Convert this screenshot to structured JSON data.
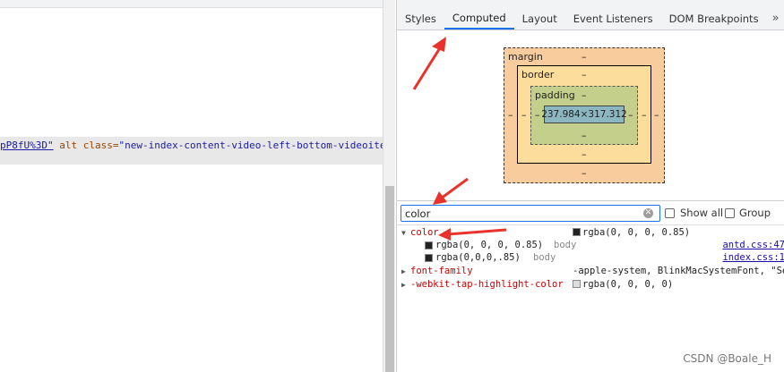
{
  "dom_line": {
    "link_text": "pP8fU%3D\"",
    "attr_alt": "alt",
    "attr_class": "class=",
    "class_value": "\"new-index-content-video-left-bottom-videoitem-cove"
  },
  "tabs": [
    {
      "label": "Styles"
    },
    {
      "label": "Computed"
    },
    {
      "label": "Layout"
    },
    {
      "label": "Event Listeners"
    },
    {
      "label": "DOM Breakpoints"
    }
  ],
  "tabs_more": "»",
  "box_model": {
    "margin_label": "margin",
    "border_label": "border",
    "padding_label": "padding",
    "dash": "–",
    "content_size": "237.984×317.312"
  },
  "filter": {
    "value": "color",
    "clear": "✕",
    "show_all_label": "Show all",
    "group_label": "Group"
  },
  "properties": {
    "color": {
      "name": "color",
      "value": "rgba(0, 0, 0, 0.85)",
      "swatch": "#222222",
      "traces": [
        {
          "value": "rgba(0, 0, 0, 0.85)",
          "selector": "body",
          "source": "antd.css:47"
        },
        {
          "value": "rgba(0,0,0,.85)",
          "selector": "body",
          "source": "index.css:1"
        }
      ]
    },
    "font_family": {
      "name": "font-family",
      "value": "-apple-system, BlinkMacSystemFont, \"Se"
    },
    "tap_highlight": {
      "name": "-webkit-tap-highlight-color",
      "value": "rgba(0, 0, 0, 0)",
      "swatch": "#dddddd"
    }
  },
  "watermark": "CSDN @Boale_H",
  "colors": {
    "accent": "#1a73e8",
    "annotation_arrow": "#e8322b",
    "margin_box": "#f9cc9d",
    "border_box": "#fddd9b",
    "padding_box": "#c3cf8a",
    "content_box": "#8cb6c0"
  }
}
